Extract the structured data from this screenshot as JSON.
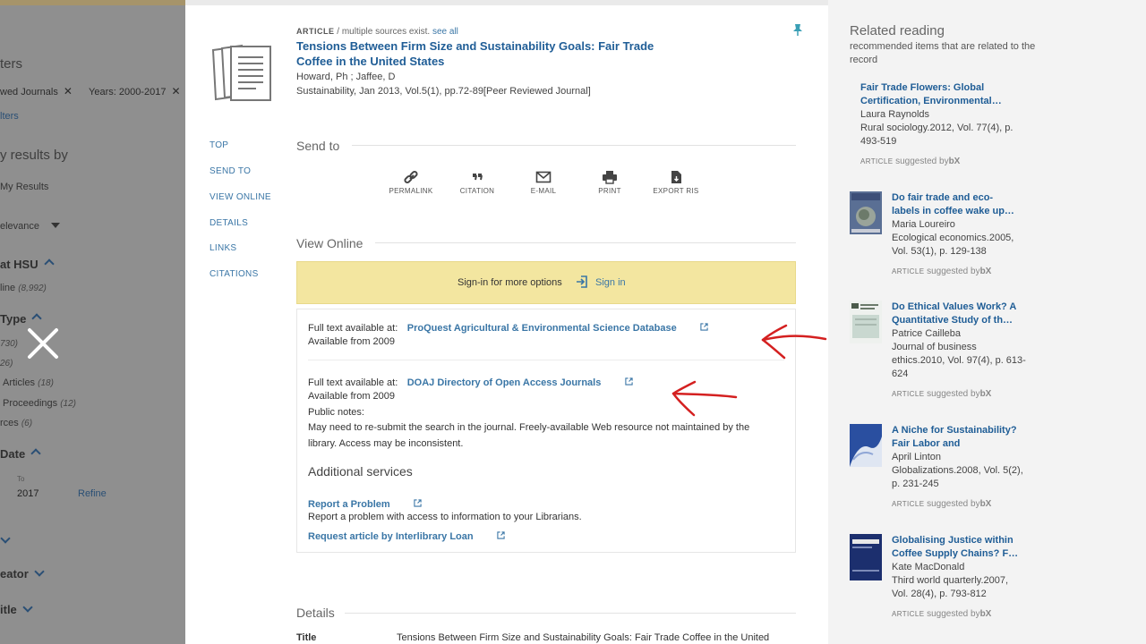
{
  "left_panel": {
    "filters_heading": "ters",
    "chips": [
      {
        "label": "wed Journals",
        "remove": "✕"
      },
      {
        "label": "Years: 2000-2017",
        "remove": "✕"
      }
    ],
    "clear_link": "lters",
    "refine_heading": "y results by",
    "my_results": "My Results",
    "sort_value": "elevance",
    "availability_heading": "at HSU",
    "availability_item": "line",
    "availability_count": "(8,992)",
    "type_heading": "Type",
    "type_items": [
      {
        "label": "",
        "count": "730)"
      },
      {
        "label": "",
        "count": "26)"
      },
      {
        "label": "Articles",
        "count": "(18)"
      },
      {
        "label": "Proceedings",
        "count": "(12)"
      },
      {
        "label": "rces",
        "count": "(6)"
      }
    ],
    "date_heading": "Date",
    "date_to_label": "To",
    "date_to_value": "2017",
    "refine_button": "Refine",
    "creator_heading": "eator",
    "title_heading": "itle"
  },
  "record": {
    "type_label": "ARTICLE",
    "multi_sources": "/ multiple sources exist.",
    "see_all": "see all",
    "title_line1": "Tensions Between Firm Size and Sustainability Goals: Fair Trade",
    "title_line2": "Coffee in the United States",
    "authors": "Howard, Ph ; Jaffee, D",
    "source": "Sustainability, Jan 2013, Vol.5(1), pp.72-89[Peer Reviewed Journal]"
  },
  "page_nav": [
    "TOP",
    "SEND TO",
    "VIEW ONLINE",
    "DETAILS",
    "LINKS",
    "CITATIONS"
  ],
  "send_to": {
    "heading": "Send to",
    "actions": [
      {
        "label": "PERMALINK",
        "icon": "link-icon"
      },
      {
        "label": "CITATION",
        "icon": "quote-icon"
      },
      {
        "label": "E-MAIL",
        "icon": "mail-icon"
      },
      {
        "label": "PRINT",
        "icon": "printer-icon"
      },
      {
        "label": "EXPORT RIS",
        "icon": "file-export-icon"
      }
    ]
  },
  "view_online": {
    "heading": "View Online",
    "banner_text": "Sign-in for more options",
    "sign_in": "Sign in",
    "services": [
      {
        "prefix": "Full text available at:",
        "link": "ProQuest Agricultural & Environmental Science Database",
        "available": "Available from 2009"
      },
      {
        "prefix": "Full text available at:",
        "link": "DOAJ Directory of Open Access Journals",
        "available": "Available from 2009",
        "notes_label": "Public notes:",
        "notes_line1": "May need to re-submit the search in the journal. Freely-available Web resource not maintained by the",
        "notes_line2": "library. Access may be inconsistent."
      }
    ],
    "additional_heading": "Additional services",
    "report_link": "Report a Problem",
    "report_desc": "Report a problem with access to information to your Librarians.",
    "ill_link": "Request article by Interlibrary Loan"
  },
  "details": {
    "heading": "Details",
    "title_label": "Title",
    "title_value": "Tensions Between Firm Size and Sustainability Goals: Fair Trade Coffee in the United"
  },
  "related": {
    "heading": "Related reading",
    "subheading": "recommended items that are related to the record",
    "suggested_type": "ARTICLE",
    "suggested_by": "suggested by",
    "bx": "bX",
    "items": [
      {
        "title1": "Fair Trade Flowers: Global",
        "title2": "Certification, Environmental…",
        "author": "Laura Raynolds",
        "src1": "Rural sociology.2012, Vol. 77(4), p.",
        "src2": "493-519",
        "src3": ""
      },
      {
        "title1": "Do fair trade and eco-",
        "title2": "labels in coffee wake up…",
        "author": "Maria Loureiro",
        "src1": "Ecological economics.2005,",
        "src2": "Vol. 53(1), p. 129-138",
        "src3": ""
      },
      {
        "title1": "Do Ethical Values Work? A",
        "title2": "Quantitative Study of th…",
        "author": "Patrice Cailleba",
        "src1": "Journal of business",
        "src2": "ethics.2010, Vol. 97(4), p. 613-",
        "src3": "624"
      },
      {
        "title1": "A Niche for Sustainability?",
        "title2": "Fair Labor and",
        "author": "April Linton",
        "src1": "Globalizations.2008, Vol. 5(2),",
        "src2": "p. 231-245",
        "src3": ""
      },
      {
        "title1": "Globalising Justice within",
        "title2": "Coffee Supply Chains? F…",
        "author": "Kate MacDonald",
        "src1": "Third world quarterly.2007,",
        "src2": "Vol. 28(4), p. 793-812",
        "src3": ""
      }
    ]
  },
  "colors": {
    "link": "#3a76a6",
    "title": "#1f5d96",
    "banner": "#f3e6a0",
    "annotation_arrow": "#d42020"
  }
}
